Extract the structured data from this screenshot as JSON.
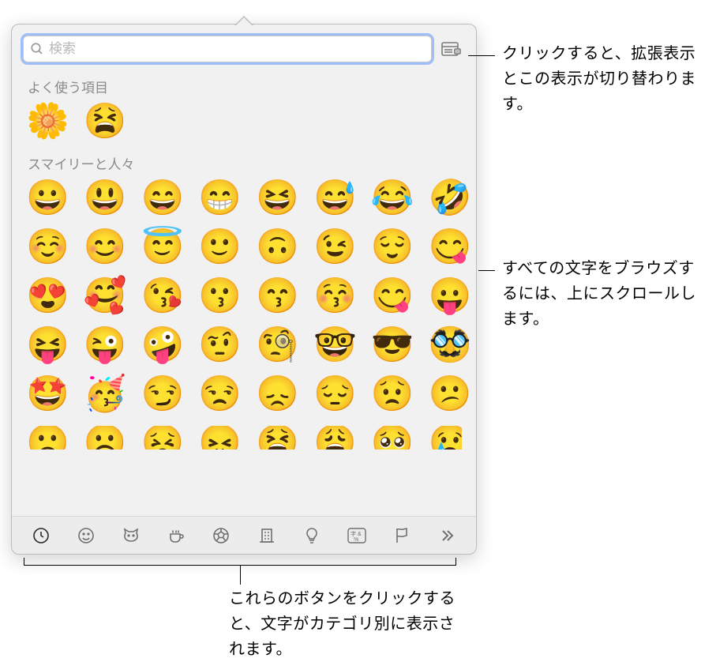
{
  "search": {
    "placeholder": "検索"
  },
  "expand_button": {
    "name": "expand-viewer-icon"
  },
  "sections": {
    "frequent": {
      "title": "よく使う項目",
      "items": [
        "🌼",
        "😫"
      ]
    },
    "smileys": {
      "title": "スマイリーと人々",
      "rows": [
        [
          "😀",
          "😃",
          "😄",
          "😁",
          "😆",
          "😅",
          "😂",
          "🤣"
        ],
        [
          "☺️",
          "😊",
          "😇",
          "🙂",
          "🙃",
          "😉",
          "😌",
          "😋"
        ],
        [
          "😍",
          "🥰",
          "😘",
          "😗",
          "😙",
          "😚",
          "😋",
          "😛"
        ],
        [
          "😝",
          "😜",
          "🤪",
          "🤨",
          "🧐",
          "🤓",
          "😎",
          "🥸"
        ],
        [
          "🤩",
          "🥳",
          "😏",
          "😒",
          "😞",
          "😔",
          "😟",
          "😕"
        ],
        [
          "🙁",
          "☹️",
          "😣",
          "😖",
          "😫",
          "😩",
          "🥺",
          "😢"
        ]
      ]
    }
  },
  "categories": [
    {
      "name": "recent-icon",
      "glyph": "clock"
    },
    {
      "name": "smileys-icon",
      "glyph": "smiley"
    },
    {
      "name": "animals-icon",
      "glyph": "cat"
    },
    {
      "name": "food-icon",
      "glyph": "cup"
    },
    {
      "name": "activity-icon",
      "glyph": "ball"
    },
    {
      "name": "travel-icon",
      "glyph": "building"
    },
    {
      "name": "objects-icon",
      "glyph": "bulb"
    },
    {
      "name": "symbols-icon",
      "glyph": "symbols"
    },
    {
      "name": "flags-icon",
      "glyph": "flag"
    },
    {
      "name": "more-icon",
      "glyph": "chevrons"
    }
  ],
  "callouts": {
    "expand": "クリックすると、拡張表示とこの表示が切り替わります。",
    "scroll": "すべての文字をブラウズするには、上にスクロールします。",
    "categories": "これらのボタンをクリックすると、文字がカテゴリ別に表示されます。"
  }
}
